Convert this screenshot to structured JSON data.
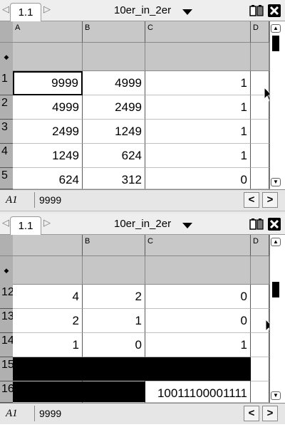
{
  "top_panel": {
    "tab_label": "1.1",
    "doc_title": "10er_in_2er",
    "columns": [
      "A",
      "B",
      "C",
      "D"
    ],
    "rows": [
      {
        "num": "1",
        "a": "9999",
        "b": "4999",
        "c": "1"
      },
      {
        "num": "2",
        "a": "4999",
        "b": "2499",
        "c": "1"
      },
      {
        "num": "3",
        "a": "2499",
        "b": "1249",
        "c": "1"
      },
      {
        "num": "4",
        "a": "1249",
        "b": "624",
        "c": "1"
      },
      {
        "num": "5",
        "a": "624",
        "b": "312",
        "c": "0"
      }
    ],
    "diamond": "◆",
    "cell_ref": "A1",
    "entry_value": "9999"
  },
  "bottom_panel": {
    "tab_label": "1.1",
    "doc_title": "10er_in_2er",
    "columns": [
      "",
      "B",
      "C",
      "D"
    ],
    "rows": [
      {
        "num": "12",
        "a": "4",
        "b": "2",
        "c": "0"
      },
      {
        "num": "13",
        "a": "2",
        "b": "1",
        "c": "0"
      },
      {
        "num": "14",
        "a": "1",
        "b": "0",
        "c": "1"
      },
      {
        "num": "15",
        "a": "",
        "b": "",
        "c": ""
      },
      {
        "num": "16",
        "a": "",
        "b": "",
        "c": "10011100001111"
      }
    ],
    "diamond": "◆",
    "cell_ref": "A1",
    "entry_value": "9999"
  },
  "icons": {
    "nav_left": "◁",
    "nav_right": "▷",
    "scroll_up": "▲",
    "scroll_down": "▼",
    "entry_left": "<",
    "entry_right": ">"
  }
}
